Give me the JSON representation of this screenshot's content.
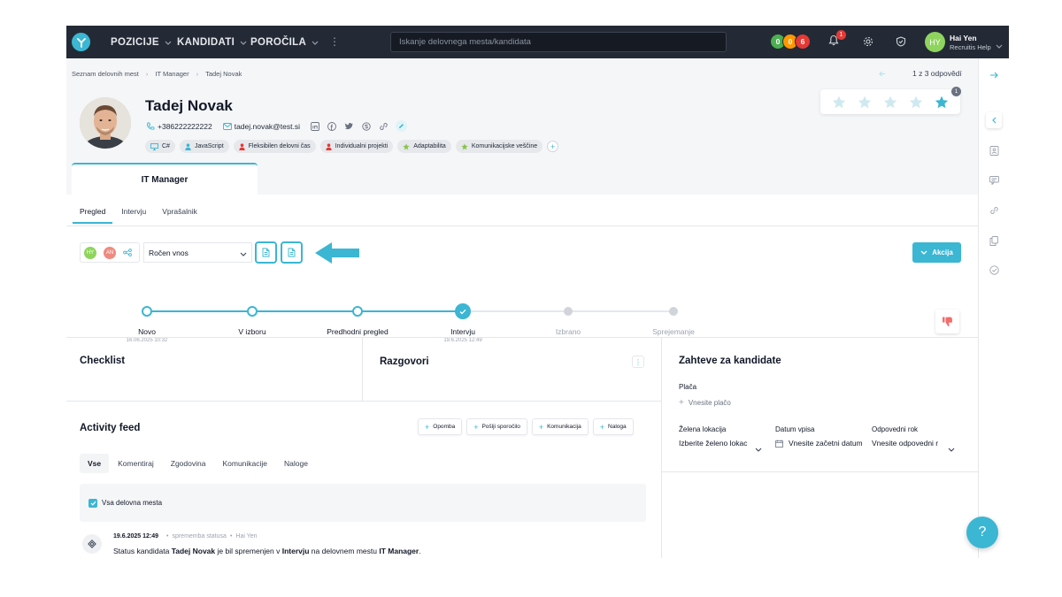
{
  "nav": {
    "items": [
      "POZICIJE",
      "KANDIDATI",
      "POROČILA"
    ],
    "search_placeholder": "Iskanje delovnega mesta/kandidata",
    "counters": [
      {
        "value": "0",
        "color": "#4caf50"
      },
      {
        "value": "0",
        "color": "#ff9800"
      },
      {
        "value": "6",
        "color": "#e53935"
      }
    ],
    "notifications": "1",
    "user": {
      "initials": "HY",
      "name": "Hai Yen",
      "org": "Recruitis Help"
    }
  },
  "breadcrumb": [
    "Seznam delovnih mest",
    "IT Manager",
    "Tadej Novak"
  ],
  "pager": "1 z 3 odpovědí",
  "candidate": {
    "name": "Tadej Novak",
    "phone": "+386222222222",
    "email": "tadej.novak@test.si",
    "rating_badge": "1",
    "rating_filled": 5,
    "tags": [
      {
        "label": "C#",
        "icon": "monitor-icon",
        "color": "#3bb6d3"
      },
      {
        "label": "JavaScript",
        "icon": "person-icon",
        "color": "#3bb6d3"
      },
      {
        "label": "Fleksibilen delovni čas",
        "icon": "person-icon",
        "color": "#e53935"
      },
      {
        "label": "Individualni projekti",
        "icon": "person-icon",
        "color": "#e53935"
      },
      {
        "label": "Adaptabilita",
        "icon": "star-icon",
        "color": "#8bc34a"
      },
      {
        "label": "Komunikacijske veščine",
        "icon": "star-icon",
        "color": "#8bc34a"
      }
    ]
  },
  "position_tab": "IT Manager",
  "subtabs": [
    "Pregled",
    "Intervju",
    "Vprašalnik"
  ],
  "toolbar": {
    "avatars": [
      {
        "initials": "HY",
        "color": "#8fd45e"
      },
      {
        "initials": "AN",
        "color": "#ef8a80"
      }
    ],
    "select_value": "Ročen vnos",
    "action_label": "Akcija"
  },
  "pipeline": [
    {
      "label": "Novo",
      "date": "16.06.2025 10:32",
      "state": "done"
    },
    {
      "label": "V izboru",
      "date": "",
      "state": "done"
    },
    {
      "label": "Predhodni pregled",
      "date": "",
      "state": "done"
    },
    {
      "label": "Intervju",
      "date": "19.6.2025 12:49",
      "state": "current"
    },
    {
      "label": "Izbrano",
      "date": "",
      "state": "pending"
    },
    {
      "label": "Sprejemanje",
      "date": "",
      "state": "pending"
    }
  ],
  "sections": {
    "checklist": "Checklist",
    "conversations": "Razgovori",
    "requirements": "Zahteve za kandidate",
    "activity": "Activity feed"
  },
  "activity_buttons": [
    "Opomba",
    "Pošlji sporočilo",
    "Komunikacija",
    "Naloga"
  ],
  "feed_tabs": [
    "Vse",
    "Komentiraj",
    "Zgodovina",
    "Komunikacije",
    "Naloge"
  ],
  "feed_filter": "Vsa delovna mesta",
  "feed_item": {
    "time": "19.6.2025 12:49",
    "type": "sprememba statusa",
    "author": "Hai Yen",
    "text_prefix": "Status kandidata ",
    "candidate": "Tadej Novak",
    "text_mid": " je bil spremenjen v ",
    "status": "Intervju",
    "text_mid2": " na delovnem mestu ",
    "position": "IT Manager",
    "text_suffix": "."
  },
  "requirements": {
    "salary_label": "Plača",
    "salary_link": "Vnesite plačo",
    "location_label": "Želena lokacija",
    "location_value": "Izberite želeno lokac",
    "start_label": "Datum vpisa",
    "start_value": "Vnesite začetni datum",
    "notice_label": "Odpovedni rok",
    "notice_value": "Vnesite odpovedni r"
  },
  "help": "?"
}
